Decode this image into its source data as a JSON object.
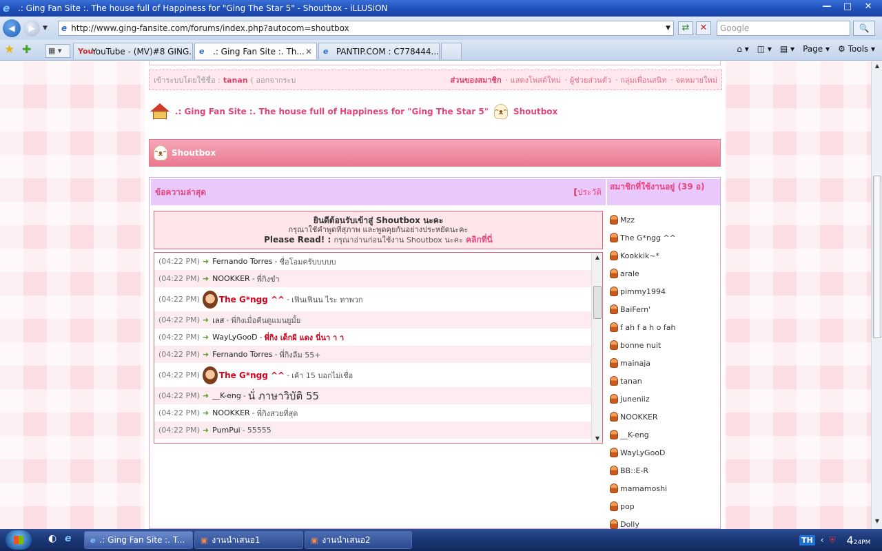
{
  "window": {
    "title": ".: Ging Fan Site :. The house full of Happiness for \"Ging The Star 5\" - Shoutbox - iLLUSiON",
    "controls": {
      "minimize": "—",
      "maximize": "□",
      "close": "✕"
    }
  },
  "address_bar": {
    "url": "http://www.ging-fansite.com/forums/index.php?autocom=shoutbox",
    "search_placeholder": "Google",
    "refresh_glyph": "⇄",
    "stop_glyph": "✕",
    "search_glyph": "🔍"
  },
  "tabs": [
    {
      "icon": "You",
      "label": "YouTube - (MV)#8 GING..."
    },
    {
      "icon": "e",
      "label": ".: Ging Fan Site :. Th...",
      "active": true
    },
    {
      "icon": "e",
      "label": "PANTIP.COM : C778444..."
    }
  ],
  "toolbar": {
    "home": "⌂",
    "page": "Page",
    "tools": "Tools"
  },
  "forum": {
    "login": {
      "prefix": "เข้าระบบโดยใช้ชื่อ :",
      "username": "tanan",
      "logout": "( ออกจากระบ",
      "member_area": "ส่วนของสมาชิก",
      "links": [
        "· แสดงโพสต์ใหม่",
        "· ผู้ช่วยส่วนตัว",
        "· กลุ่มเพื่อนสนิท",
        "· จดหมายใหม่"
      ]
    },
    "breadcrumb": {
      "site": ".: Ging Fan Site :. The house full of Happiness for \"Ging The Star 5\"",
      "page": "Shoutbox"
    },
    "shoutbox_title": "Shoutbox",
    "latest_heading": "ข้อความล่าสุด",
    "history_link": "ประวัติ",
    "history_bracket": "[",
    "online_heading": "สมาชิกที่ใช้งานอยู่ (39 อ)",
    "welcome": {
      "line1": "ยินดีต้อนรับเข้าสู่ Shoutbox นะคะ",
      "line2": "กรุณาใช้คำพูดที่สุภาพ และพูดคุยกันอย่างประหยัดนะคะ",
      "read_label": "Please Read! :",
      "read_note": "กรุณาอ่านก่อนใช้งาน Shoutbox นะคะ",
      "read_link": "คลิกที่นี่"
    },
    "messages": [
      {
        "time": "(04:22 PM)",
        "user": "Fernando Torres",
        "text": "ชื่อโอมครับบบบบ",
        "style": "normal"
      },
      {
        "time": "(04:22 PM)",
        "user": "NOOKKER",
        "text": "พี่กิงขำ",
        "style": "normal"
      },
      {
        "time": "(04:22 PM)",
        "user": "The G*ngg ^^",
        "text": "เฟินเฟินน ไระ ทาพวก",
        "style": "vip"
      },
      {
        "time": "(04:22 PM)",
        "user": "เลส",
        "text": "พี่กิงเมื่อคืนดูแมนยูมั้ย",
        "style": "normal"
      },
      {
        "time": "(04:22 PM)",
        "user": "WayLyGooD",
        "text": "พี่กิง เด็กผี แดง นี่นา า า",
        "style": "redtext"
      },
      {
        "time": "(04:22 PM)",
        "user": "Fernando Torres",
        "text": "พี่กิงลืม 55+",
        "style": "normal"
      },
      {
        "time": "(04:22 PM)",
        "user": "The G*ngg ^^",
        "text": "เค้า 15 บอกไม่เชื่อ",
        "style": "vip"
      },
      {
        "time": "(04:22 PM)",
        "user": "__K-eng",
        "text": "นั่ ภาษาวิบัติ 55",
        "style": "big"
      },
      {
        "time": "(04:22 PM)",
        "user": "NOOKKER",
        "text": "พี่กิงสวยที่สุด",
        "style": "normal"
      },
      {
        "time": "(04:22 PM)",
        "user": "PumPui",
        "text": "55555",
        "style": "normal"
      }
    ],
    "online_users": [
      "Mzz",
      "The G*ngg ^^",
      "Kookkik~*",
      "arale",
      "pimmy1994",
      "BaiFern'",
      "f ah f a h o fah",
      "bonne nuit",
      "mainaja",
      "tanan",
      "juneniiz",
      "NOOKKER",
      "__K-eng",
      "WayLyGooD",
      "BB::E-R",
      "mamamoshi",
      "pop",
      "Dolly"
    ]
  },
  "taskbar": {
    "items": [
      {
        "label": ".: Ging Fan Site :. T...",
        "active": true
      },
      {
        "label": "งานนำเสนอ1"
      },
      {
        "label": "งานนำเสนอ2"
      }
    ],
    "lang": "TH",
    "clock": "4",
    "clock_small": "24",
    "clock_ampm": "PM"
  },
  "colors": {
    "accent_pink": "#e8457e",
    "header_lilac": "#e9c9fb",
    "vip_red": "#d0021b"
  }
}
